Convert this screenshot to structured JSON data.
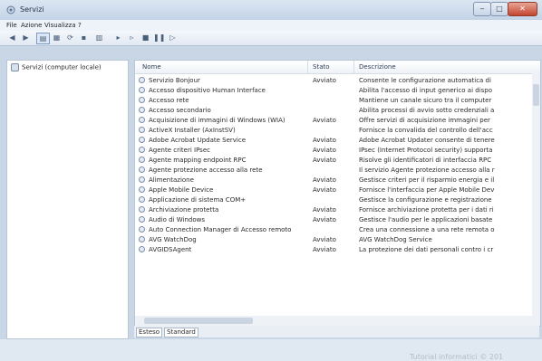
{
  "window": {
    "title": "Servizi"
  },
  "menu": [
    "File",
    "Azione",
    "Visualizza",
    "?"
  ],
  "tree": {
    "item": "Servizi (computer locale)"
  },
  "list": {
    "columns": [
      "Nome",
      "Stato",
      "Descrizione"
    ],
    "rows": [
      {
        "name": "Servizio Bonjour",
        "status": "Avviato",
        "desc": "Consente le configurazione automatica di"
      },
      {
        "name": "Accesso dispositivo Human Interface",
        "status": "",
        "desc": "Abilita l'accesso di input generico ai dispo"
      },
      {
        "name": "Accesso rete",
        "status": "",
        "desc": "Mantiene un canale sicuro tra il computer"
      },
      {
        "name": "Accesso secondario",
        "status": "",
        "desc": "Abilita processi di avvio sotto credenziali a"
      },
      {
        "name": "Acquisizione di immagini di Windows (WIA)",
        "status": "Avviato",
        "desc": "Offre servizi di acquisizione immagini per"
      },
      {
        "name": "ActiveX Installer (AxInstSV)",
        "status": "",
        "desc": "Fornisce la convalida del controllo dell'acc"
      },
      {
        "name": "Adobe Acrobat Update Service",
        "status": "Avviato",
        "desc": "Adobe Acrobat Updater consente di tenere"
      },
      {
        "name": "Agente criteri IPsec",
        "status": "Avviato",
        "desc": "IPsec (Internet Protocol security) supporta"
      },
      {
        "name": "Agente mapping endpoint RPC",
        "status": "Avviato",
        "desc": "Risolve gli identificatori di interfaccia RPC"
      },
      {
        "name": "Agente protezione accesso alla rete",
        "status": "",
        "desc": "Il servizio Agente protezione accesso alla r"
      },
      {
        "name": "Alimentazione",
        "status": "Avviato",
        "desc": "Gestisce criteri per il risparmio energia e il"
      },
      {
        "name": "Apple Mobile Device",
        "status": "Avviato",
        "desc": "Fornisce l'interfaccia per Apple Mobile Dev"
      },
      {
        "name": "Applicazione di sistema COM+",
        "status": "",
        "desc": "Gestisce la configurazione e registrazione"
      },
      {
        "name": "Archiviazione protetta",
        "status": "Avviato",
        "desc": "Fornisce archiviazione protetta per i dati ri"
      },
      {
        "name": "Audio di Windows",
        "status": "Avviato",
        "desc": "Gestisce l'audio per le applicazioni basate"
      },
      {
        "name": "Auto Connection Manager di Accesso remoto",
        "status": "",
        "desc": "Crea una connessione a una rete remota o"
      },
      {
        "name": "AVG WatchDog",
        "status": "Avviato",
        "desc": "AVG WatchDog Service"
      },
      {
        "name": "AVGIDSAgent",
        "status": "Avviato",
        "desc": "La protezione dei dati personali contro i cr"
      }
    ]
  },
  "tabs": [
    "Esteso",
    "Standard"
  ],
  "watermark": "Tutorial informatici © 201",
  "colors": {
    "titlebar": "#c3d3e6",
    "close": "#c2452f",
    "selected": "#dbe7f6"
  },
  "icons": [
    "back-arrow-icon",
    "forward-arrow-icon",
    "console-tree-icon",
    "properties-icon",
    "refresh-icon",
    "help-icon",
    "export-icon",
    "play-icon",
    "play-alt-icon",
    "stop-icon",
    "pause-icon",
    "restart-icon"
  ]
}
